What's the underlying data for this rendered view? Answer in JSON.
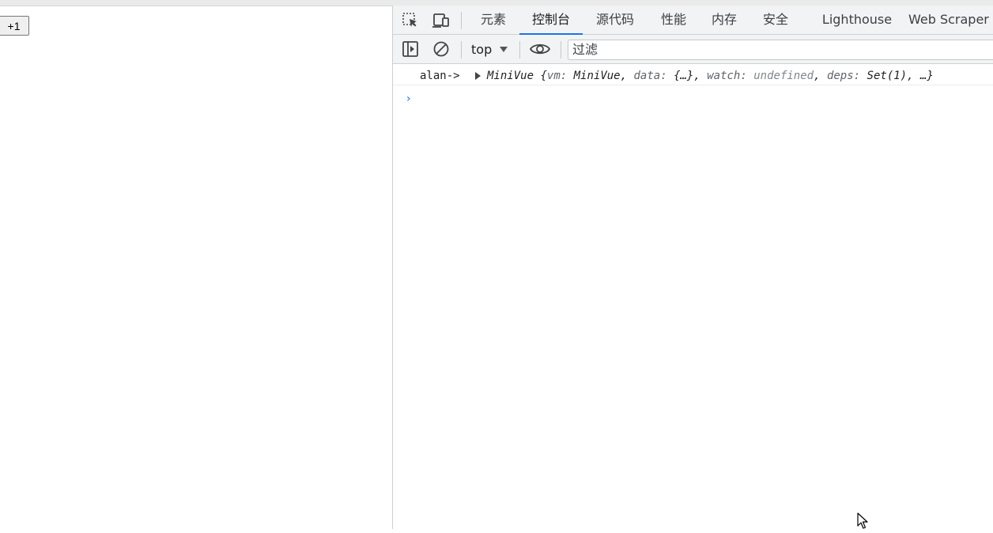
{
  "page": {
    "button_label": "+1"
  },
  "devtools": {
    "tabs": [
      {
        "label": "元素"
      },
      {
        "label": "控制台"
      },
      {
        "label": "源代码"
      },
      {
        "label": "性能"
      },
      {
        "label": "内存"
      },
      {
        "label": "安全"
      },
      {
        "label": "Lighthouse"
      },
      {
        "label": "Web Scraper"
      }
    ],
    "active_tab": "控制台",
    "toolbar": {
      "context": "top",
      "filter_placeholder": "过滤"
    },
    "console": {
      "log_prefix": "alan->",
      "object_name": "MiniVue",
      "object_open": "{",
      "key_vm": "vm: ",
      "val_vm": "MiniVue",
      "sep1": ", ",
      "key_data": "data: ",
      "val_data": "{…}",
      "sep2": ", ",
      "key_watch": "watch: ",
      "val_watch": "undefined",
      "sep3": ", ",
      "key_deps": "deps: ",
      "val_deps": "Set(1)",
      "sep4": ", ",
      "tail": "…}",
      "prompt_glyph": "›"
    },
    "colors": {
      "accent": "#1a73e8",
      "toolbar_bg": "#f1f3f4"
    },
    "icons": [
      "inspect-element-icon",
      "device-toolbar-icon",
      "sidebar-toggle-icon",
      "clear-console-icon",
      "eye-icon",
      "dropdown-caret-icon",
      "mouse-cursor-icon"
    ]
  }
}
